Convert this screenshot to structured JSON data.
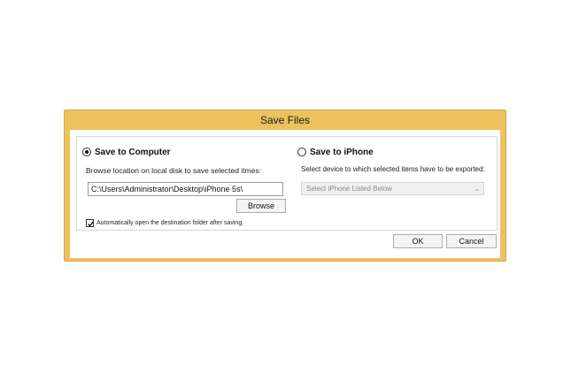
{
  "dialog": {
    "title": "Save Files",
    "save_to_computer": {
      "label": "Save to Computer",
      "selected": true,
      "browse_prompt": "Browse location on local disk to save selected itmes:",
      "path_value": "C:\\Users\\Administrator\\Desktop\\iPhone 5s\\",
      "browse_label": "Browse"
    },
    "save_to_iphone": {
      "label": "Save to iPhone",
      "selected": false,
      "device_prompt": "Select device to which selected items have to be exported:",
      "device_select_value": "Select iPhone Listed Below"
    },
    "auto_open": {
      "label": "Automatically open the destination folder after saving.",
      "checked": true
    },
    "ok_label": "OK",
    "cancel_label": "Cancel"
  },
  "colors": {
    "frame": "#ecc15e",
    "client": "#ffffff",
    "disabled_text": "#8a8a8a"
  },
  "icons": {
    "radio_selected": "radio-selected-icon",
    "radio_unselected": "radio-unselected-icon",
    "checkbox_checked": "checkmark-icon",
    "dropdown": "chevron-down-icon"
  }
}
